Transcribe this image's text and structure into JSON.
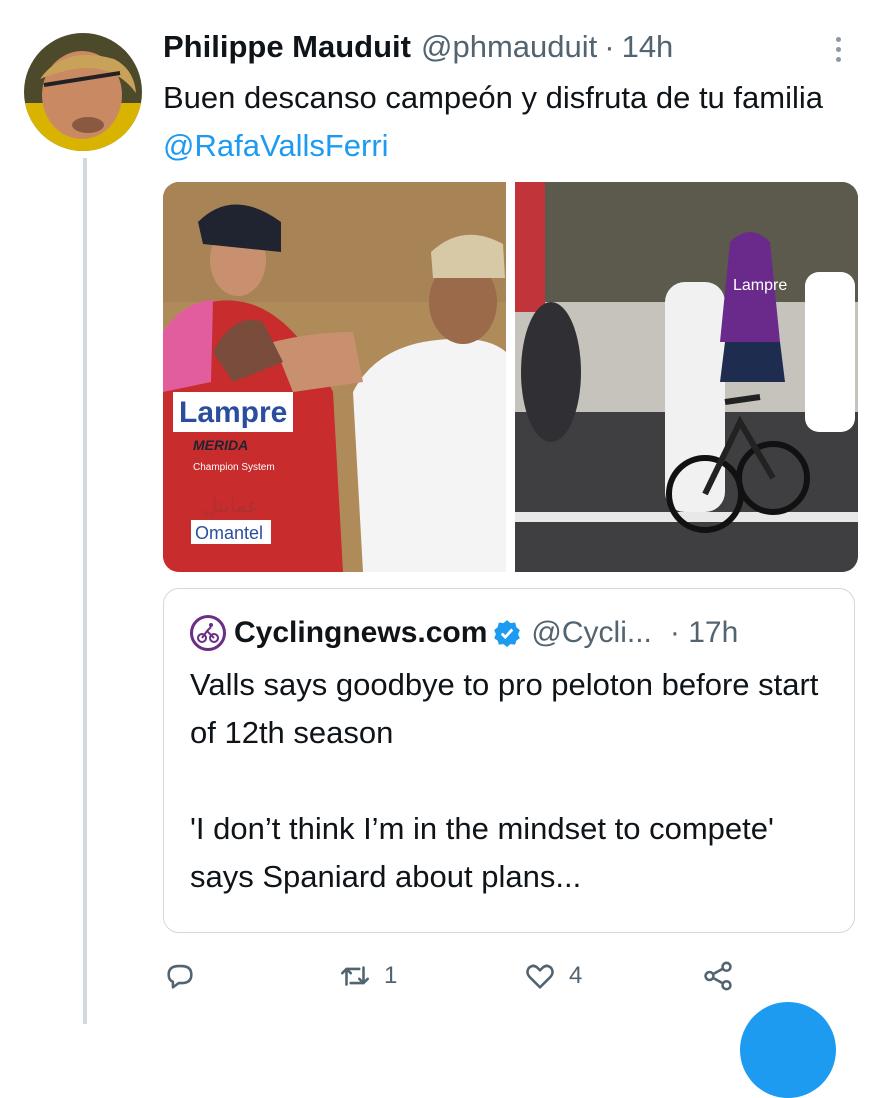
{
  "tweet": {
    "author_name": "Philippe Mauduit",
    "handle": "@phmauduit",
    "separator": "·",
    "time": "14h",
    "text": "Buen descanso campeón y disfruta de tu familia ",
    "mention": "@RafaVallsFerri"
  },
  "quote": {
    "author_name": "Cyclingnews.com",
    "handle": "@Cycli...",
    "separator": "·",
    "time": "17h",
    "text": "Valls says goodbye to pro peloton before start of 12th season\n\n'I don’t think I’m in the mindset to compete' says Spaniard about plans..."
  },
  "media": {
    "image1_texts": [
      "Lampre",
      "MERIDA",
      "Champion System",
      "عمانتل",
      "Omantel"
    ],
    "image2_texts": [
      "Lampre"
    ]
  },
  "actions": {
    "reply_count": "",
    "retweet_count": "1",
    "like_count": "4"
  },
  "colors": {
    "accent": "#1d9bf0",
    "secondary_text": "#536471",
    "border": "#cfd9de"
  }
}
